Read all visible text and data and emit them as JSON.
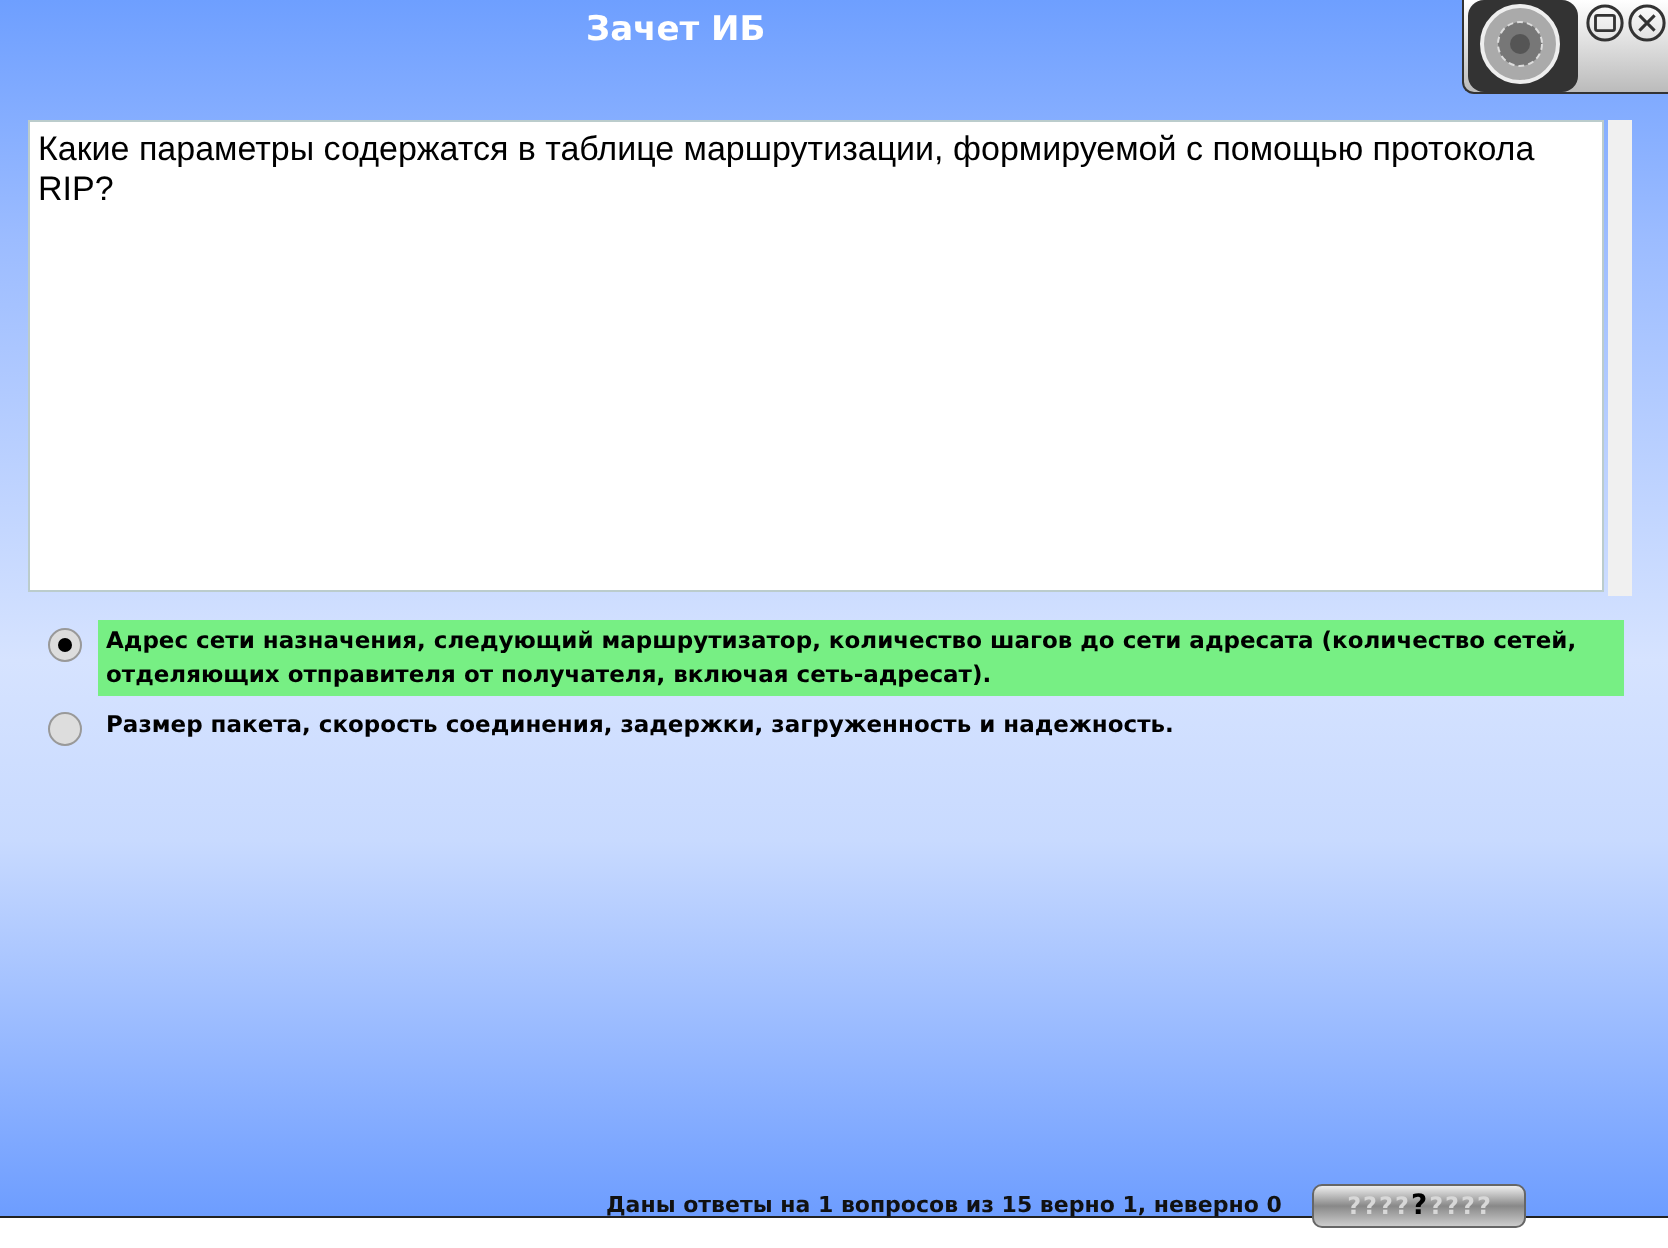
{
  "window": {
    "title": "Зачет ИБ"
  },
  "question": {
    "text": "Какие параметры содержатся в таблице маршрутизации, формируемой с помощью протокола RIP?"
  },
  "answers": [
    {
      "text": "Адрес сети назначения, следующий маршрутизатор, количество шагов до сети адресата (количество сетей, отделяющих отправителя от получателя, включая сеть-адресат).",
      "selected": true
    },
    {
      "text": "Размер пакета, скорость соединения, задержки, загруженность и надежность.",
      "selected": false
    }
  ],
  "status": {
    "text": "Даны ответы на 1 вопросов из 15 верно 1, неверно 0"
  },
  "navigator": [
    {
      "label": "?",
      "current": false
    },
    {
      "label": "?",
      "current": false
    },
    {
      "label": "?",
      "current": false
    },
    {
      "label": "?",
      "current": false
    },
    {
      "label": "?",
      "current": true
    },
    {
      "label": "?",
      "current": false
    },
    {
      "label": "?",
      "current": false
    },
    {
      "label": "?",
      "current": false
    },
    {
      "label": "?",
      "current": false
    }
  ]
}
